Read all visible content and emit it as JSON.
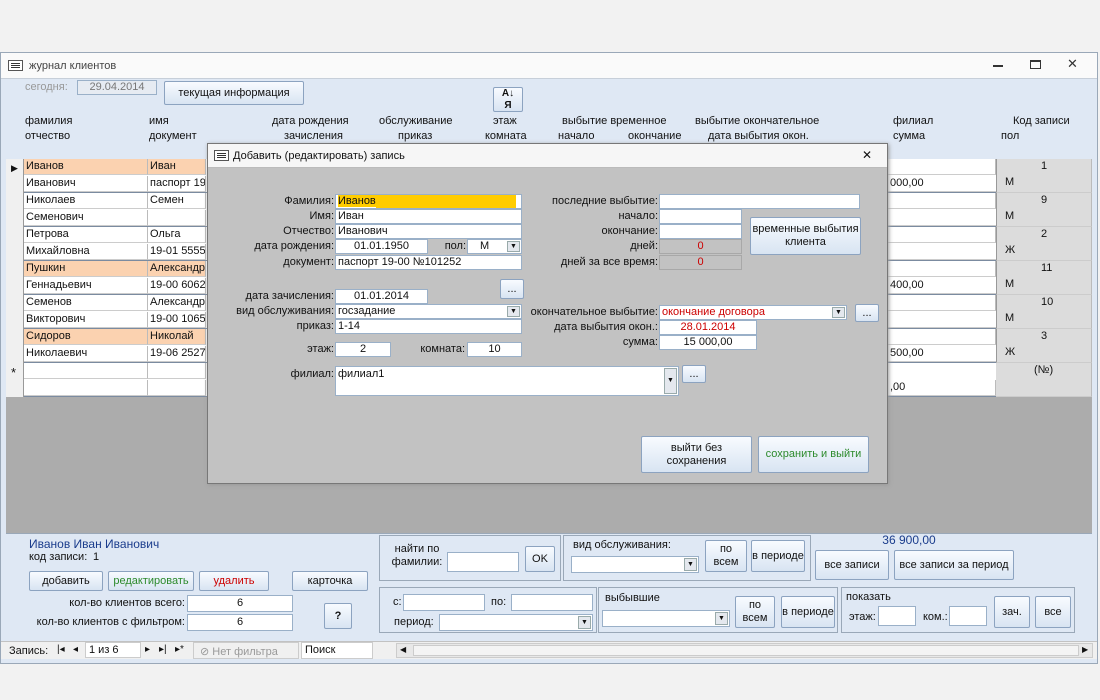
{
  "window": {
    "title": "журнал клиентов",
    "icon": "form-icon",
    "controls": [
      "minimize-icon",
      "maximize-icon",
      "close-icon"
    ]
  },
  "header": {
    "today_label": "сегодня:",
    "today_value": "29.04.2014",
    "current_info": "текущая информация",
    "sort_icon": "sort-az-icon"
  },
  "columns": {
    "c1a": "фамилия",
    "c1b": "отчество",
    "c2a": "имя",
    "c2b": "документ",
    "c3a": "дата рождения",
    "c3b": "зачисления",
    "c4a": "обслуживание",
    "c4b": "приказ",
    "c5a": "этаж",
    "c5b": "комната",
    "c6a": "выбытие временное",
    "c6b1": "начало",
    "c6b2": "окончание",
    "c7a": "выбытие окончательное",
    "c7b": "дата выбытия окон.",
    "c8a": "филиал",
    "c8b": "сумма",
    "c9a": "Код записи",
    "c9b": "пол"
  },
  "rows": [
    {
      "last": "Иванов",
      "first": "Иван",
      "middle": "Иванович",
      "doc": "паспорт 19",
      "sum": "000,00",
      "gender": "М",
      "id": "1",
      "hl": true
    },
    {
      "last": "Николаев",
      "first": "Семен",
      "middle": "Семенович",
      "doc": "",
      "sum": "",
      "gender": "М",
      "id": "9",
      "hl": false
    },
    {
      "last": "Петрова",
      "first": "Ольга",
      "middle": "Михайловна",
      "doc": "19-01 55550",
      "sum": "",
      "gender": "Ж",
      "id": "2",
      "hl": false
    },
    {
      "last": "Пушкин",
      "first": "Александр",
      "middle": "Геннадьевич",
      "doc": "19-00 60629",
      "sum": "400,00",
      "gender": "М",
      "id": "11",
      "hl": true
    },
    {
      "last": "Семенов",
      "first": "Александр",
      "middle": "Викторович",
      "doc": "19-00 10659",
      "sum": "",
      "gender": "М",
      "id": "10",
      "hl": false
    },
    {
      "last": "Сидоров",
      "first": "Николай",
      "middle": "Николаевич",
      "doc": "19-06 25274",
      "sum": "500,00",
      "gender": "Ж",
      "id": "3",
      "hl": true
    }
  ],
  "newrow": {
    "marker": "*",
    "sum": ",00",
    "id": "(№)"
  },
  "dialog": {
    "title": "Добавить (редактировать) запись",
    "lbl_last": "Фамилия:",
    "val_last": "Иванов",
    "lbl_first": "Имя:",
    "val_first": "Иван",
    "lbl_middle": "Отчество:",
    "val_middle": "Иванович",
    "lbl_birth": "дата рождения:",
    "val_birth": "01.01.1950",
    "lbl_gender": "пол:",
    "val_gender": "М",
    "lbl_doc": "документ:",
    "val_doc": "паспорт 19-00 №101252",
    "lbl_enroll": "дата зачисления:",
    "val_enroll": "01.01.2014",
    "lbl_service": "вид обслуживания:",
    "val_service": "госзадание",
    "lbl_order": "приказ:",
    "val_order": "1-14",
    "lbl_floor": "этаж:",
    "val_floor": "2",
    "lbl_room": "комната:",
    "val_room": "10",
    "lbl_branch": "филиал:",
    "val_branch": "филиал1",
    "lbl_last_out": "последние выбытие:",
    "lbl_start": "начало:",
    "lbl_end": "окончание:",
    "lbl_days": "дней:",
    "val_days": "0",
    "lbl_days_all": "дней за все время:",
    "val_days_all": "0",
    "temp_btn": "временные выбытия клиента",
    "lbl_final": "окончательное выбытие:",
    "val_final": "окончание договора",
    "lbl_final_date": "дата выбытия окон.:",
    "val_final_date": "28.01.2014",
    "lbl_sum": "сумма:",
    "val_sum": "15 000,00",
    "dots": "...",
    "exit_btn": "выйти без сохранения",
    "save_btn": "сохранить и выйти"
  },
  "footer": {
    "client_name": "Иванов Иван Иванович",
    "record_label": "код записи:",
    "record_value": "1",
    "add": "добавить",
    "edit": "редактировать",
    "delete": "удалить",
    "card": "карточка",
    "total_label": "кол-во клиентов всего:",
    "total_value": "6",
    "filter_label": "кол-во клиентов с фильтром:",
    "filter_value": "6",
    "help": "?",
    "find_label": "найти по фамилии:",
    "ok": "OK",
    "service_label": "вид обслуживания:",
    "by_all": "по всем",
    "in_period": "в периоде",
    "sum_total": "36 900,00",
    "all_records": "все записи",
    "all_period": "все записи за период",
    "from_label": "с:",
    "to_label": "по:",
    "period_label": "период:",
    "departed_label": "выбывшие",
    "show_label": "показать",
    "floor_label": "этаж:",
    "room_label": "ком.:",
    "zach": "зач.",
    "vse": "все"
  },
  "status": {
    "record_label": "Запись:",
    "position": "1 из 6",
    "no_filter": "Нет фильтра",
    "search": "Поиск"
  },
  "colors": {
    "highlight_row": "#fbd2b0",
    "focus_field": "#ffcc00",
    "red_text": "#cc0000",
    "green_text": "#2c8a2c",
    "window_bg": "#dfe8f4",
    "dialog_bg": "#c2c2c2"
  }
}
